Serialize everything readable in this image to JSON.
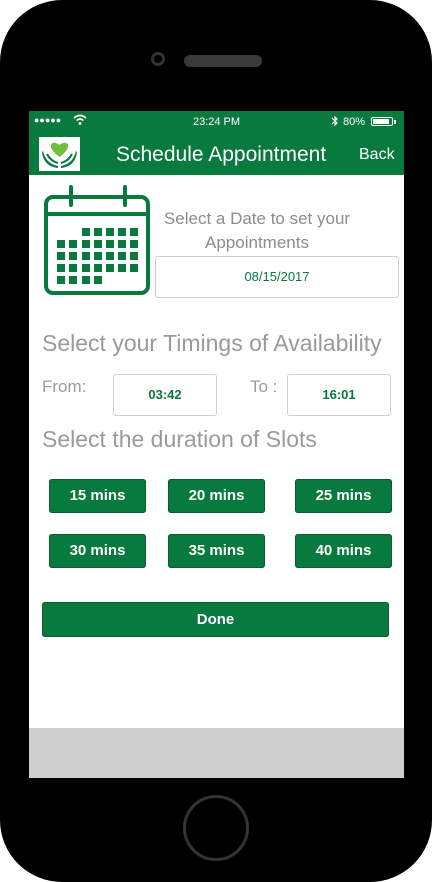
{
  "status_bar": {
    "signal": "●●●●●",
    "time": "23:24 PM",
    "battery_percent": "80%"
  },
  "nav": {
    "title": "Schedule Appointment",
    "back_label": "Back"
  },
  "date_section": {
    "prompt": "Select a Date to set your Appointments",
    "selected_date": "08/15/2017"
  },
  "timing_section": {
    "heading": "Select your Timings of Availability",
    "from_label": "From:",
    "from_value": "03:42",
    "to_label": "To :",
    "to_value": "16:01"
  },
  "slots_section": {
    "heading": "Select the duration of Slots",
    "options": [
      "15 mins",
      "20 mins",
      "25 mins",
      "30 mins",
      "35 mins",
      "40 mins"
    ]
  },
  "done_label": "Done",
  "colors": {
    "brand_green": "#087a3e",
    "muted_text": "#9a9a9a",
    "bottom_bar": "#cfcfcf"
  }
}
